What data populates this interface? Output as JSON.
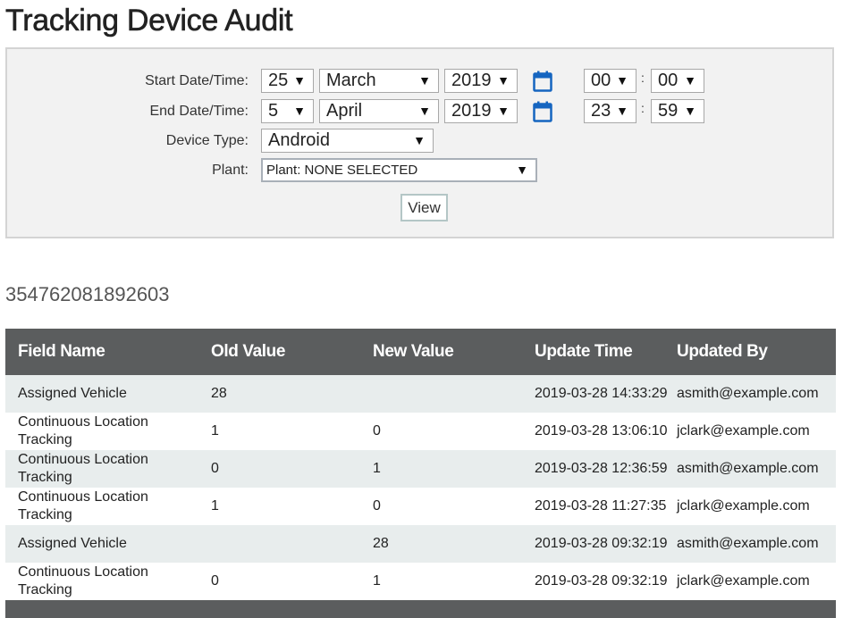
{
  "page": {
    "title": "Tracking Device Audit"
  },
  "filters": {
    "start_label": "Start Date/Time:",
    "end_label": "End Date/Time:",
    "device_type_label": "Device Type:",
    "plant_label": "Plant:",
    "start": {
      "day": "25",
      "month": "March",
      "year": "2019",
      "hour": "00",
      "minute": "00"
    },
    "end": {
      "day": "5",
      "month": "April",
      "year": "2019",
      "hour": "23",
      "minute": "59"
    },
    "device_type": "Android",
    "plant": "Plant: NONE SELECTED",
    "time_separator": ":",
    "dropdown_arrow": "▼",
    "view_button": "View"
  },
  "device_id": "354762081892603",
  "table": {
    "headers": [
      "Field Name",
      "Old Value",
      "New Value",
      "Update Time",
      "Updated By"
    ],
    "rows": [
      [
        "Assigned Vehicle",
        "28",
        "",
        "2019-03-28 14:33:29",
        "asmith@example.com"
      ],
      [
        "Continuous Location Tracking",
        "1",
        "0",
        "2019-03-28 13:06:10",
        "jclark@example.com"
      ],
      [
        "Continuous Location Tracking",
        "0",
        "1",
        "2019-03-28 12:36:59",
        "asmith@example.com"
      ],
      [
        "Continuous Location Tracking",
        "1",
        "0",
        "2019-03-28 11:27:35",
        "jclark@example.com"
      ],
      [
        "Assigned Vehicle",
        "",
        "28",
        "2019-03-28 09:32:19",
        "asmith@example.com"
      ],
      [
        "Continuous Location Tracking",
        "0",
        "1",
        "2019-03-28 09:32:19",
        "jclark@example.com"
      ]
    ]
  },
  "colors": {
    "accent_calendar": "#1565c0",
    "table_header_bg": "#5b5d5e",
    "row_alt_bg": "#e8eded"
  },
  "icons": {
    "calendar": "calendar-icon"
  }
}
